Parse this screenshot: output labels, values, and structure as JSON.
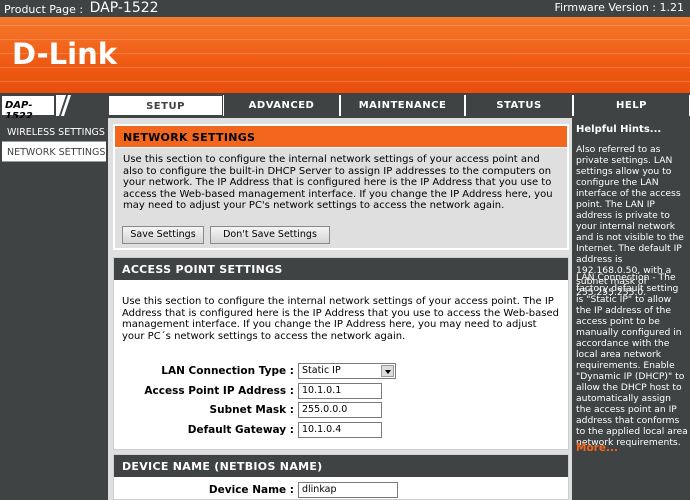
{
  "header": {
    "product_label": "Product Page :",
    "product_model": "DAP-1522",
    "firmware": "Firmware Version : 1.21"
  },
  "brand": {
    "logo_text": "D-Link",
    "accent": "#f2661e",
    "dark": "#404343"
  },
  "nav": {
    "model_badge": "DAP-1522",
    "tabs": [
      {
        "label": "SETUP",
        "active": true
      },
      {
        "label": "ADVANCED",
        "active": false
      },
      {
        "label": "MAINTENANCE",
        "active": false
      },
      {
        "label": "STATUS",
        "active": false
      },
      {
        "label": "HELP",
        "active": false
      }
    ]
  },
  "sidebar": {
    "items": [
      {
        "label": "WIRELESS SETTINGS",
        "active": false
      },
      {
        "label": "NETWORK SETTINGS",
        "active": true
      }
    ]
  },
  "network_settings": {
    "title": "NETWORK SETTINGS",
    "description": "Use this section to configure the internal network settings of your access point and also to configure the built-in DHCP Server to assign IP addresses to the computers on your network. The IP Address that is configured here is the IP Address that you use to access the Web-based management interface. If you change the IP Address here, you may need to adjust your PC's network settings to access the network again.",
    "save_label": "Save Settings",
    "dont_save_label": "Don't Save Settings"
  },
  "ap_settings": {
    "title": "ACCESS POINT SETTINGS",
    "description": "Use this section to configure the internal network settings of your access point. The IP Address that is configured here is the IP Address that you use to access the Web-based management interface. If you change the IP Address here, you may need to adjust your PC´s network settings to access the network again.",
    "lan_type_label": "LAN Connection Type :",
    "lan_type_value": "Static IP",
    "ip_label": "Access Point IP Address :",
    "ip_value": "10.1.0.1",
    "mask_label": "Subnet Mask :",
    "mask_value": "255.0.0.0",
    "gateway_label": "Default Gateway :",
    "gateway_value": "10.1.0.4"
  },
  "device_name": {
    "title": "DEVICE NAME (NETBIOS NAME)",
    "label": "Device Name :",
    "value": "dlinkap"
  },
  "hints": {
    "title": "Helpful Hints...",
    "p1": "Also referred to as private settings. LAN settings allow you to configure the LAN interface of the access point. The LAN IP address is private to your internal network and is not visible to the Internet. The default IP address is 192.168.0.50, with a subnet mask of 255.255.255.0.",
    "p2": "LAN Connection - The factory default setting is \"Static IP\" to allow the IP address of the access point to be manually configured in accordance with the local area network requirements. Enable \"Dynamic IP (DHCP)\" to allow the DHCP host to automatically assign the access point an IP address that conforms to the applied local area network requirements.",
    "more": "More..."
  }
}
